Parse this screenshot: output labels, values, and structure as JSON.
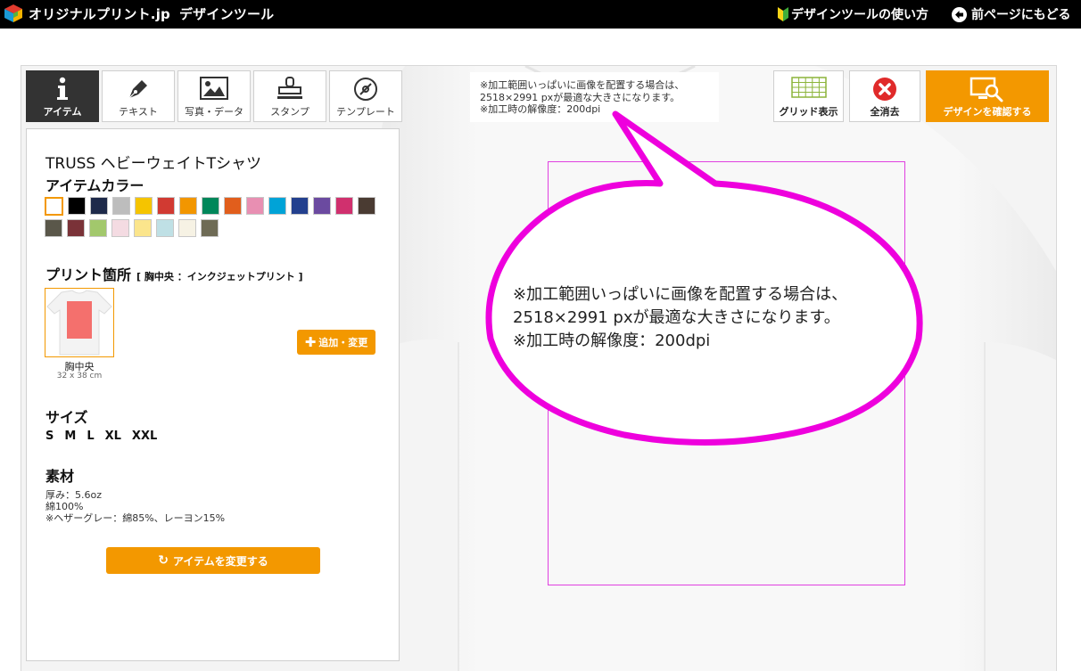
{
  "topbar": {
    "logo_text": "オリジナルプリント.jp",
    "logo_sub": "デザインツール",
    "howto_label": "デザインツールの使い方",
    "back_label": "前ページにもどる"
  },
  "tabs": [
    {
      "label": "アイテム",
      "icon": "info-icon",
      "active": true
    },
    {
      "label": "テキスト",
      "icon": "pen-icon",
      "active": false
    },
    {
      "label": "写真・データ",
      "icon": "image-icon",
      "active": false
    },
    {
      "label": "スタンプ",
      "icon": "stamp-icon",
      "active": false
    },
    {
      "label": "テンプレート",
      "icon": "disc-icon",
      "active": false
    }
  ],
  "panel": {
    "item_name": "TRUSS ヘビーウェイトTシャツ",
    "color_title": "アイテムカラー",
    "colors": [
      "#ffffff",
      "#000000",
      "#1e2a4a",
      "#bdbdbd",
      "#f5c400",
      "#d13a32",
      "#f29600",
      "#00875a",
      "#e15e1c",
      "#e88fb2",
      "#00a3d7",
      "#23408e",
      "#6b4aa0",
      "#d0306e",
      "#4a3b32",
      "#5a574a",
      "#7a3238",
      "#a2c86c",
      "#f4dbe2",
      "#fbe58c",
      "#bfe0e5",
      "#f6f2e4",
      "#6e6b55"
    ],
    "selected_color": 0,
    "print_title": "プリント箇所",
    "print_note": "[ 胸中央 ：インクジェットプリント ]",
    "thumb_label": "胸中央",
    "thumb_size": "32 x 38 cm",
    "add_button": "追加・変更",
    "size_title": "サイズ",
    "sizes": [
      "S",
      "M",
      "L",
      "XL",
      "XXL"
    ],
    "material_title": "素材",
    "material_lines": [
      "厚み：5.6oz",
      "綿100%",
      "※ヘザーグレー：綿85%、レーヨン15%"
    ],
    "change_button": "アイテムを変更する"
  },
  "info_box": {
    "lines": [
      "※加工範囲いっぱいに画像を配置する場合は、",
      "2518×2991 pxが最適な大きさになります。",
      "※加工時の解像度：200dpi"
    ]
  },
  "right_buttons": {
    "grid": "グリッド表示",
    "clear": "全消去",
    "confirm": "デザインを確認する"
  },
  "callout": {
    "lines": [
      "※加工範囲いっぱいに画像を配置する場合は、",
      "2518×2991 pxが最適な大きさになります。",
      "※加工時の解像度：200dpi"
    ],
    "stroke_color": "#ee00dd"
  },
  "colors": {
    "accent": "#f39800",
    "print_area_border": "#e040e0",
    "topbar": "#000000"
  }
}
